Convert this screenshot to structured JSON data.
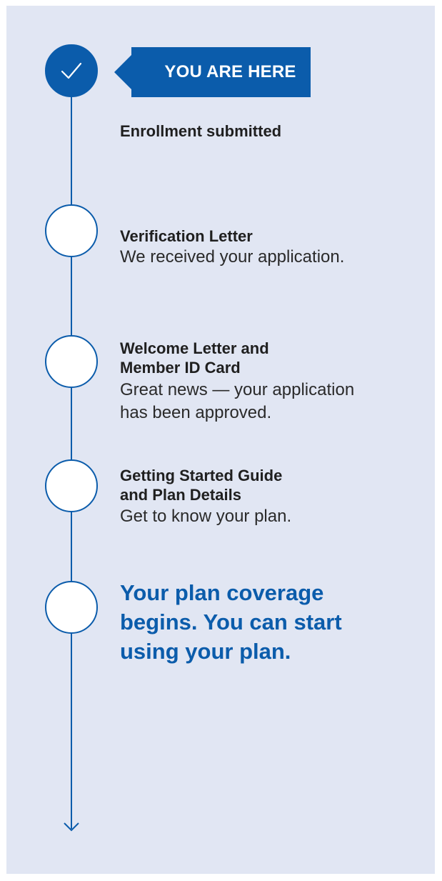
{
  "colors": {
    "primary_blue": "#0b5cab",
    "panel_bg": "#e1e6f3",
    "text_dark": "#1f1f1f"
  },
  "badge": {
    "label": "YOU ARE HERE"
  },
  "steps": [
    {
      "title": "Enrollment submitted",
      "description": "",
      "status": "complete",
      "icon": "check-icon"
    },
    {
      "title": "Verification Letter",
      "description": "We received your application.",
      "status": "pending"
    },
    {
      "title": "Welcome Letter and\nMember ID Card",
      "description": "Great news — your application\nhas been approved.",
      "status": "pending"
    },
    {
      "title": "Getting Started Guide\nand Plan Details",
      "description": "Get to know your plan.",
      "status": "pending"
    },
    {
      "title": "Your plan coverage\nbegins. You can start\nusing your plan.",
      "description": "",
      "status": "pending",
      "emphasis": true
    }
  ]
}
